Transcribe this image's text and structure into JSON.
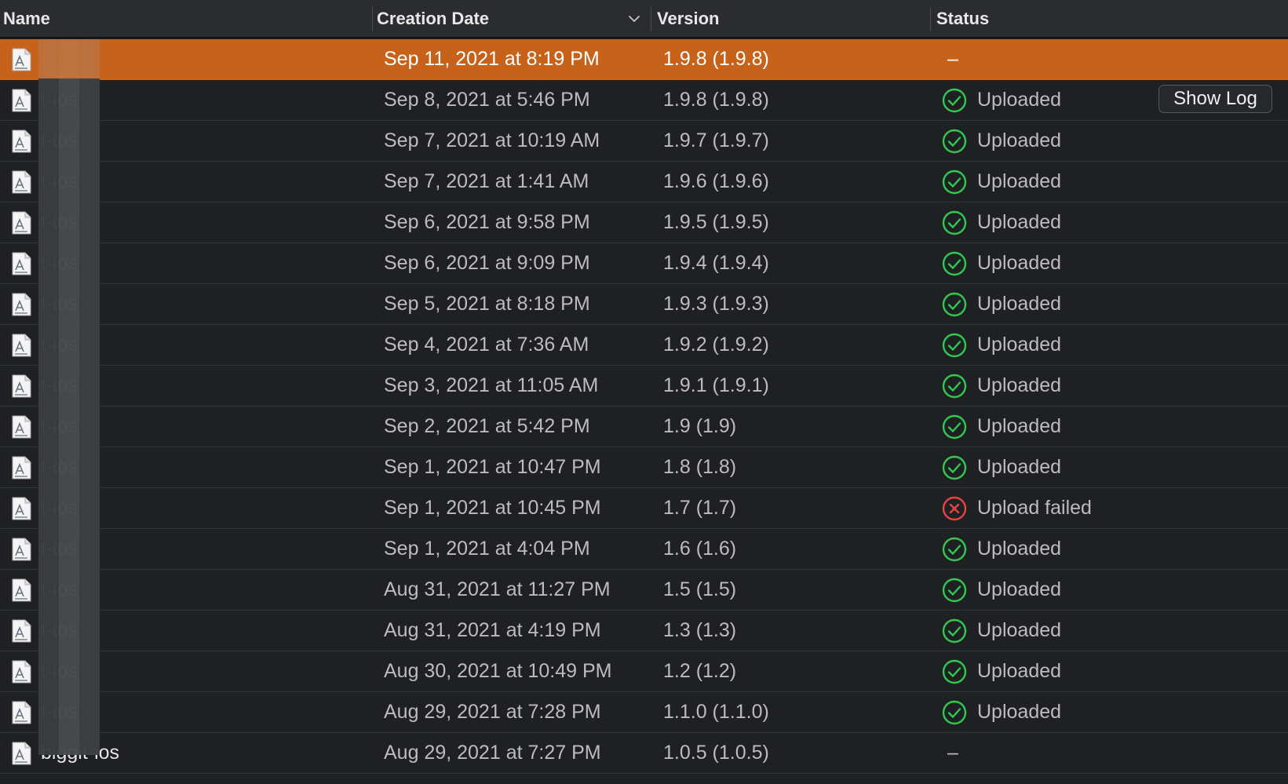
{
  "header": {
    "name": "Name",
    "creation_date": "Creation Date",
    "version": "Version",
    "status": "Status"
  },
  "show_log_label": "Show Log",
  "icons": {
    "file": "app-archive-file-icon",
    "uploaded": "checkmark-circle-icon",
    "failed": "x-circle-icon",
    "sort": "chevron-down-icon"
  },
  "colors": {
    "selected_row": "#c6621a",
    "success": "#30c94f",
    "failure": "#e5463e"
  },
  "rows": [
    {
      "name": "t-ios",
      "date": "Sep 11, 2021 at 8:19 PM",
      "version": "1.9.8 (1.9.8)",
      "status": "–",
      "state": "none"
    },
    {
      "name": "t-ios",
      "date": "Sep 8, 2021 at 5:46 PM",
      "version": "1.9.8 (1.9.8)",
      "status": "Uploaded",
      "state": "ok"
    },
    {
      "name": "t-ios",
      "date": "Sep 7, 2021 at 10:19 AM",
      "version": "1.9.7 (1.9.7)",
      "status": "Uploaded",
      "state": "ok"
    },
    {
      "name": "t-ios",
      "date": "Sep 7, 2021 at 1:41 AM",
      "version": "1.9.6 (1.9.6)",
      "status": "Uploaded",
      "state": "ok"
    },
    {
      "name": "t-ios",
      "date": "Sep 6, 2021 at 9:58 PM",
      "version": "1.9.5 (1.9.5)",
      "status": "Uploaded",
      "state": "ok"
    },
    {
      "name": "t-ios",
      "date": "Sep 6, 2021 at 9:09 PM",
      "version": "1.9.4 (1.9.4)",
      "status": "Uploaded",
      "state": "ok"
    },
    {
      "name": "t-ios",
      "date": "Sep 5, 2021 at 8:18 PM",
      "version": "1.9.3 (1.9.3)",
      "status": "Uploaded",
      "state": "ok"
    },
    {
      "name": "t-ios",
      "date": "Sep 4, 2021 at 7:36 AM",
      "version": "1.9.2 (1.9.2)",
      "status": "Uploaded",
      "state": "ok"
    },
    {
      "name": "t-ios",
      "date": "Sep 3, 2021 at 11:05 AM",
      "version": "1.9.1 (1.9.1)",
      "status": "Uploaded",
      "state": "ok"
    },
    {
      "name": "t-ios",
      "date": "Sep 2, 2021 at 5:42 PM",
      "version": "1.9 (1.9)",
      "status": "Uploaded",
      "state": "ok"
    },
    {
      "name": "t-ios",
      "date": "Sep 1, 2021 at 10:47 PM",
      "version": "1.8 (1.8)",
      "status": "Uploaded",
      "state": "ok"
    },
    {
      "name": "t-ios",
      "date": "Sep 1, 2021 at 10:45 PM",
      "version": "1.7 (1.7)",
      "status": "Upload failed",
      "state": "fail"
    },
    {
      "name": "t-ios",
      "date": "Sep 1, 2021 at 4:04 PM",
      "version": "1.6 (1.6)",
      "status": "Uploaded",
      "state": "ok"
    },
    {
      "name": "t-ios",
      "date": "Aug 31, 2021 at 11:27 PM",
      "version": "1.5 (1.5)",
      "status": "Uploaded",
      "state": "ok"
    },
    {
      "name": "t-ios",
      "date": "Aug 31, 2021 at 4:19 PM",
      "version": "1.3 (1.3)",
      "status": "Uploaded",
      "state": "ok"
    },
    {
      "name": "t-ios",
      "date": "Aug 30, 2021 at 10:49 PM",
      "version": "1.2 (1.2)",
      "status": "Uploaded",
      "state": "ok"
    },
    {
      "name": "t-ios",
      "date": "Aug 29, 2021 at 7:28 PM",
      "version": "1.1.0 (1.1.0)",
      "status": "Uploaded",
      "state": "ok"
    },
    {
      "name": "biggit-ios",
      "date": "Aug 29, 2021 at 7:27 PM",
      "version": "1.0.5 (1.0.5)",
      "status": "–",
      "state": "none"
    }
  ]
}
